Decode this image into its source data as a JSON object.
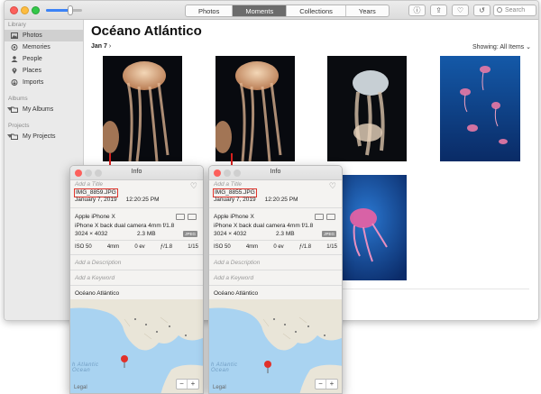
{
  "window": {
    "tabs": [
      "Photos",
      "Moments",
      "Collections",
      "Years"
    ],
    "active_tab": "Moments",
    "search_placeholder": "Search",
    "toolbar_icons": [
      "info-icon",
      "share-icon",
      "heart-icon",
      "rotate-icon"
    ]
  },
  "sidebar": {
    "library_header": "Library",
    "library_items": [
      {
        "label": "Photos",
        "icon": "photos-icon",
        "selected": true
      },
      {
        "label": "Memories",
        "icon": "memories-icon"
      },
      {
        "label": "People",
        "icon": "people-icon"
      },
      {
        "label": "Places",
        "icon": "places-icon"
      },
      {
        "label": "Imports",
        "icon": "imports-icon"
      }
    ],
    "albums_header": "Albums",
    "albums_item": "My Albums",
    "projects_header": "Projects",
    "projects_item": "My Projects"
  },
  "main": {
    "title": "Océano Atlántico",
    "date": "Jan 7",
    "date_sep": "›",
    "showing_label": "Showing:",
    "showing_value": "All Items"
  },
  "info_panels": [
    {
      "window_title": "Info",
      "add_title": "Add a Title",
      "filename": "IMG_8859.JPG",
      "date": "January 7, 2019",
      "time": "12:20:25 PM",
      "camera": "Apple iPhone X",
      "lens": "iPhone X back dual camera 4mm f/1.8",
      "dimensions": "3024 × 4032",
      "filesize": "2.3 MB",
      "format": "JPEG",
      "exif": [
        "ISO 50",
        "4mm",
        "0 ev",
        "ƒ/1.8",
        "1/15"
      ],
      "add_description": "Add a Description",
      "add_keyword": "Add a Keyword",
      "place": "Océano Atlántico",
      "map_label": "h Atlantic\nOcean",
      "legal": "Legal",
      "zoom_minus": "−",
      "zoom_plus": "+"
    },
    {
      "window_title": "Info",
      "add_title": "Add a Title",
      "filename": "IMG_8855.JPG",
      "date": "January 7, 2019",
      "time": "12:20:25 PM",
      "camera": "Apple iPhone X",
      "lens": "iPhone X back dual camera 4mm f/1.8",
      "dimensions": "3024 × 4032",
      "filesize": "2.3 MB",
      "format": "JPEG",
      "exif": [
        "ISO 50",
        "4mm",
        "0 ev",
        "ƒ/1.8",
        "1/15"
      ],
      "add_description": "Add a Description",
      "add_keyword": "Add a Keyword",
      "place": "Océano Atlántico",
      "map_label": "h Atlantic\nOcean",
      "legal": "Legal",
      "zoom_minus": "−",
      "zoom_plus": "+"
    }
  ],
  "colors": {
    "accent_red": "#d9201e",
    "selected_tab": "#6c6c6c",
    "map_water": "#a9d3f1",
    "map_land": "#e9e5d8"
  }
}
